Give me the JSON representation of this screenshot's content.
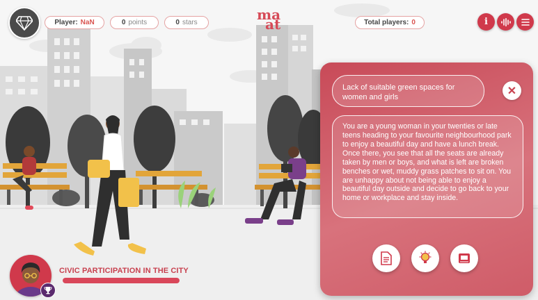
{
  "header": {
    "player_label": "Player:",
    "player_value": "NaN",
    "points_value": "0",
    "points_label": "points",
    "stars_value": "0",
    "stars_label": "stars",
    "brand_line1": "ma",
    "brand_line2": "at",
    "total_players_label": "Total players:",
    "total_players_value": "0",
    "info_icon": "info-icon",
    "audio_icon": "audio-wave-icon",
    "menu_icon": "hamburger-icon",
    "logo_icon": "diamond-icon"
  },
  "card": {
    "title": "Lack of suitable green spaces for women and girls",
    "body": "You are a young woman in your twenties or late teens heading to your favourite neighbourhood park to enjoy a beautiful day and have a lunch break. Once there, you see that all the seats are already taken by men or boys, and what is left are broken benches or wet, muddy grass patches to sit on. You are unhappy about not being able to enjoy a beautiful day outside and decide to go back to your home or workplace and stay inside.",
    "close_icon": "close-icon",
    "actions": [
      "document-icon",
      "lightbulb-icon",
      "book-icon"
    ]
  },
  "player_panel": {
    "level_title": "CIVIC PARTICIPATION IN THE CITY",
    "progress": 1.0,
    "avatar_icon": "avatar",
    "badge_icon": "trophy-icon"
  },
  "colors": {
    "accent": "#d0394b",
    "card": "#cf5c68",
    "dark": "#3a3a3a",
    "building": "#cfcfcf"
  }
}
